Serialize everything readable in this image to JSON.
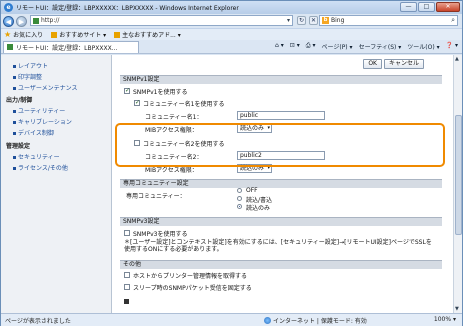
{
  "window": {
    "title": "リモートUI：設定/登録：LBPXXXXX：LBPXXXXX - Windows Internet Explorer",
    "min": "—",
    "max": "□",
    "close": "✕"
  },
  "addressbar": {
    "url": "http://",
    "search_engine": "Bing",
    "search_icon": "⌕"
  },
  "favbar": {
    "favorites": "お気に入り",
    "item1": "おすすめサイト ▾",
    "item2": "主なおすすめアド... ▾"
  },
  "tab": {
    "label": "リモートUI：設定/登録：LBPXXXX..."
  },
  "commandbar": {
    "page": "ページ(P) ▾",
    "safety": "セーフティ(S) ▾",
    "tools": "ツール(O) ▾",
    "help": "❓ ▾"
  },
  "leftnav": {
    "items_top": [
      "レイアウト",
      "印字調整",
      "ユーザーメンテナンス"
    ],
    "head1": "出力/制御",
    "items_mid": [
      "ユーティリティー",
      "キャリブレーション",
      "デバイス制御"
    ],
    "head2": "管理設定",
    "items_bot": [
      "セキュリティー",
      "ライセンス/その他"
    ]
  },
  "main": {
    "ok_label": "OK",
    "cancel_label": "キャンセル",
    "snmpv1_header": "SNMPv1設定",
    "snmpv1_use": "SNMPv1を使用する",
    "community1_use": "コミュニティー名1を使用する",
    "community1_label": "コミュニティー名1：",
    "community1_value": "public",
    "mib1_label": "MIBアクセス権限：",
    "mib1_value": "読込のみ",
    "community2_use": "コミュニティー名2を使用する",
    "community2_label": "コミュニティー名2：",
    "community2_value": "public2",
    "mib2_label": "MIBアクセス権限：",
    "mib2_value": "読込のみ",
    "dedicated_header": "専用コミュニティー設定",
    "dedicated_label": "専用コミュニティー：",
    "opt_off": "OFF",
    "opt_rw": "読込/書込",
    "opt_ro": "読込のみ",
    "snmpv3_header": "SNMPv3設定",
    "snmpv3_use": "SNMPv3を使用する",
    "snmpv3_note": "＊[ユーザー設定]とコンテキスト設定]を有効にするには、[セキュリティー設定]→[リモートUI設定]ページでSSLを使用するONにする必要があります。",
    "other_header": "その他",
    "other_opt1": "ホストからプリンター管理情報を取得する",
    "other_opt2": "スリープ時のSNMPパケット受信を固定する"
  },
  "statusbar": {
    "status": "ページが表示されました",
    "zone": "インターネット | 保護モード: 有効",
    "zoom": "100% ▾"
  }
}
